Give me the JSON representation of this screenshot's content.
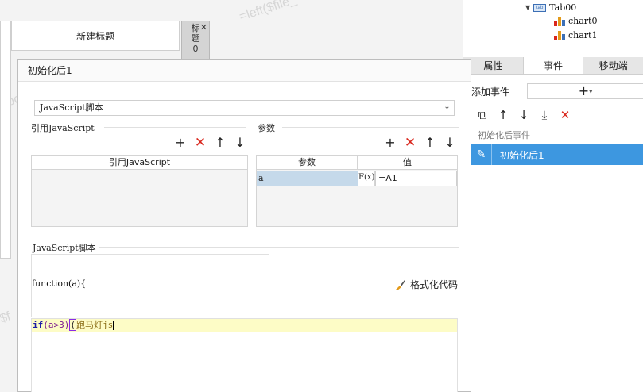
{
  "canvas": {
    "watermarks": [
      "=left($file_",
      "pbo_",
      "=left($file_",
      "$f"
    ],
    "new_title_cell": "新建标题",
    "tab_label_strip": "标\n题\n0",
    "tab_label_close": "✕"
  },
  "tree": {
    "tab_node": {
      "badge": "tab",
      "label": "Tab00"
    },
    "children": [
      {
        "label": "chart0"
      },
      {
        "label": "chart1"
      }
    ]
  },
  "panel_tabs": [
    {
      "label": "属性",
      "active": false
    },
    {
      "label": "事件",
      "active": true
    },
    {
      "label": "移动端",
      "active": false
    }
  ],
  "events": {
    "add_label": "添加事件",
    "add_button": "+",
    "group_label": "初始化后事件",
    "selected_item": "初始化后1"
  },
  "dialog": {
    "title": "初始化后1",
    "script_type": "JavaScript脚本",
    "ref_js_group": "引用JavaScript",
    "ref_js_column": "引用JavaScript",
    "params_group": "参数",
    "params_columns": {
      "name": "参数",
      "value": "值"
    },
    "params_rows": [
      {
        "name": "a",
        "fx": "F(x)",
        "value": "=A1"
      }
    ],
    "script_group": "JavaScript脚本",
    "format_button": "格式化代码",
    "code": {
      "function_line": "function(a){",
      "keyword": "if",
      "condition": "(a>3)",
      "paren": "(",
      "string": "跑马灯js"
    }
  }
}
